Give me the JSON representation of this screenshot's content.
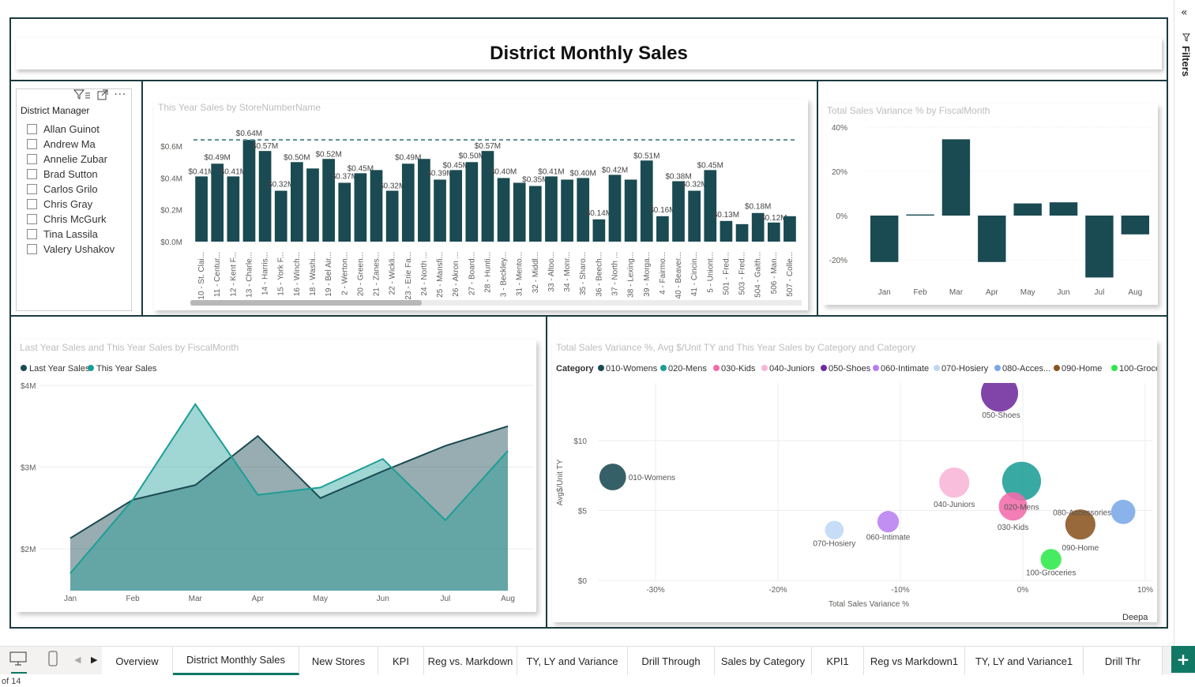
{
  "page_title": "District Monthly Sales",
  "filters_pane": {
    "label": "Filters"
  },
  "slicer": {
    "title": "District Manager",
    "items": [
      "Allan Guinot",
      "Andrew Ma",
      "Annelie Zubar",
      "Brad Sutton",
      "Carlos Grilo",
      "Chris Gray",
      "Chris McGurk",
      "Tina Lassila",
      "Valery Ushakov"
    ]
  },
  "colors": {
    "dark_teal": "#1a4a52",
    "teal": "#1c9e96",
    "tab_accent": "#117865"
  },
  "store_chart": {
    "title": "This Year Sales by StoreNumberName",
    "chart_data": {
      "type": "bar",
      "categories": [
        "10 - St. Clai...",
        "11 - Centur...",
        "12 - Kent F...",
        "13 - Charle...",
        "14 - Harris...",
        "15 - York F...",
        "16 - Winch...",
        "18 - Washi...",
        "19 - Bel Air...",
        "2 - Werton...",
        "20 - Green...",
        "21 - Zanes...",
        "22 - Wickli...",
        "23 - Erie Fa...",
        "24 - North ...",
        "25 - Mansfi...",
        "26 - Akron ...",
        "27 - Board...",
        "28 - Hunti...",
        "3 - Beckley...",
        "31 - Mento...",
        "32 - Middl...",
        "33 - Altoo...",
        "34 - Monr...",
        "35 - Sharo...",
        "36 - Beech...",
        "37 - North ...",
        "38 - Lexing...",
        "39 - Morga...",
        "4 - Fairmo...",
        "40 - Beaver...",
        "41 - Cincin...",
        "5 - Uniont...",
        "501 - Fred...",
        "503 - Fred...",
        "504 - Gaith...",
        "506 - Man...",
        "507 - Colle..."
      ],
      "values": [
        0.41,
        0.49,
        0.41,
        0.64,
        0.57,
        0.32,
        0.5,
        0.46,
        0.52,
        0.37,
        0.43,
        0.45,
        0.32,
        0.49,
        0.52,
        0.39,
        0.45,
        0.5,
        0.57,
        0.4,
        0.37,
        0.35,
        0.41,
        0.39,
        0.4,
        0.14,
        0.42,
        0.39,
        0.51,
        0.16,
        0.38,
        0.32,
        0.45,
        0.13,
        0.11,
        0.18,
        0.12,
        0.16
      ],
      "data_labels": [
        "$0.41M",
        "$0.49M",
        "$0.41M",
        "$0.64M",
        "$0.57M",
        "$0.32M",
        "$0.50M",
        "",
        "$0.52M",
        "$0.37M",
        "$0.45M",
        "",
        "$0.32M",
        "$0.49M",
        "",
        "$0.39M",
        "$0.45M",
        "$0.50M",
        "$0.57M",
        "$0.40M",
        "",
        "$0.35M",
        "$0.41M",
        "",
        "$0.40M",
        "$0.14M",
        "$0.42M",
        "",
        "$0.51M",
        "$0.16M",
        "$0.38M",
        "$0.32M",
        "$0.45M",
        "$0.13M",
        "",
        "$0.18M",
        "$0.12M",
        ""
      ],
      "yticks": [
        "$0.0M",
        "$0.2M",
        "$0.4M",
        "$0.6M"
      ],
      "ylim": [
        0,
        0.7
      ],
      "reference_line": 0.64
    }
  },
  "variance_chart": {
    "title": "Total Sales Variance % by FiscalMonth",
    "chart_data": {
      "type": "bar",
      "categories": [
        "Jan",
        "Feb",
        "Mar",
        "Apr",
        "May",
        "Jun",
        "Jul",
        "Aug"
      ],
      "values": [
        -21,
        0.5,
        34.5,
        -21,
        5.5,
        6,
        -28,
        -8.5
      ],
      "yticks": [
        "40%",
        "20%",
        "0%",
        "-20%"
      ],
      "ylim": [
        -30,
        40
      ]
    }
  },
  "area_chart": {
    "title": "Last Year Sales and This Year Sales by FiscalMonth",
    "legend": [
      "Last Year Sales",
      "This Year Sales"
    ],
    "chart_data": {
      "type": "area",
      "categories": [
        "Jan",
        "Feb",
        "Mar",
        "Apr",
        "May",
        "Jun",
        "Jul",
        "Aug"
      ],
      "series": [
        {
          "name": "Last Year Sales",
          "values": [
            2.13,
            2.6,
            2.78,
            3.38,
            2.62,
            2.95,
            3.26,
            3.5
          ]
        },
        {
          "name": "This Year Sales",
          "values": [
            1.7,
            2.6,
            3.77,
            2.66,
            2.75,
            3.1,
            2.35,
            3.2
          ]
        }
      ],
      "yticks": [
        "$2M",
        "$3M",
        "$4M"
      ],
      "ylim": [
        1.5,
        4.0
      ]
    }
  },
  "scatter_chart": {
    "title": "Total Sales Variance %, Avg $/Unit TY and This Year Sales by Category and Category",
    "legend_title": "Category",
    "legend": [
      "010-Womens",
      "020-Mens",
      "030-Kids",
      "040-Juniors",
      "050-Shoes",
      "060-Intimate",
      "070-Hosiery",
      "080-Acces...",
      "090-Home",
      "100-Groce..."
    ],
    "xlabel": "Total Sales Variance %",
    "ylabel": "Avg$/Unit TY",
    "xticks": [
      "-30%",
      "-20%",
      "-10%",
      "0%",
      "10%"
    ],
    "yticks": [
      "$0",
      "$5",
      "$10"
    ],
    "footer_text": "Deepa",
    "chart_data": {
      "type": "scatter",
      "xlim": [
        -35,
        10
      ],
      "ylim": [
        0,
        13
      ],
      "points": [
        {
          "label": "010-Womens",
          "x": -33.5,
          "y": 7.4,
          "size": 0.45,
          "color": "#1a4a52"
        },
        {
          "label": "020-Mens",
          "x": -0.1,
          "y": 7.1,
          "size": 0.8,
          "color": "#1c9e96"
        },
        {
          "label": "030-Kids",
          "x": -0.8,
          "y": 5.3,
          "size": 0.5,
          "color": "#f26bab"
        },
        {
          "label": "040-Juniors",
          "x": -5.6,
          "y": 7.0,
          "size": 0.55,
          "color": "#f8b5d7"
        },
        {
          "label": "050-Shoes",
          "x": -1.9,
          "y": 13.4,
          "size": 0.75,
          "color": "#6f2b9e"
        },
        {
          "label": "060-Intimate",
          "x": -11.0,
          "y": 4.2,
          "size": 0.3,
          "color": "#b87ef0"
        },
        {
          "label": "070-Hosiery",
          "x": -15.4,
          "y": 3.6,
          "size": 0.22,
          "color": "#bfd8f6"
        },
        {
          "label": "080-Accessories",
          "x": 8.2,
          "y": 4.9,
          "size": 0.38,
          "color": "#7aa8e8"
        },
        {
          "label": "090-Home",
          "x": 4.7,
          "y": 4.0,
          "size": 0.55,
          "color": "#8a5420"
        },
        {
          "label": "100-Groceries",
          "x": 2.3,
          "y": 1.5,
          "size": 0.28,
          "color": "#2ee84a"
        }
      ]
    }
  },
  "tabs": [
    {
      "label": "Overview",
      "active": false
    },
    {
      "label": "District Monthly Sales",
      "active": true
    },
    {
      "label": "New Stores",
      "active": false
    },
    {
      "label": "KPI",
      "active": false
    },
    {
      "label": "Reg vs. Markdown",
      "active": false
    },
    {
      "label": "TY, LY and Variance",
      "active": false
    },
    {
      "label": "Drill Through",
      "active": false
    },
    {
      "label": "Sales by Category",
      "active": false
    },
    {
      "label": "KPI1",
      "active": false
    },
    {
      "label": "Reg vs Markdown1",
      "active": false
    },
    {
      "label": "TY, LY and Variance1",
      "active": false
    },
    {
      "label": "Drill Thr",
      "active": false
    }
  ],
  "page_count": "of 14"
}
